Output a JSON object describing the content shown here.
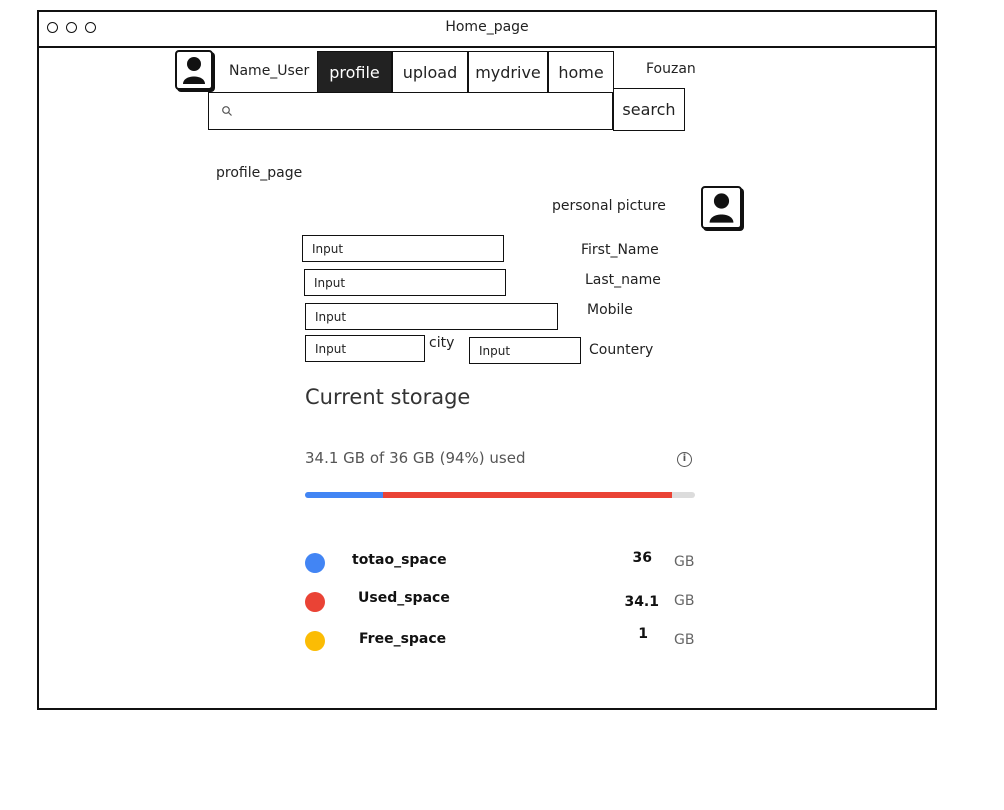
{
  "window": {
    "title": "Home_page"
  },
  "nav": {
    "username": "Name_User",
    "tabs": [
      "profile",
      "upload",
      "mydrive",
      "home"
    ],
    "right_name": "Fouzan"
  },
  "search": {
    "button": "search",
    "placeholder": ""
  },
  "profile": {
    "title": "profile_page",
    "picture_label": "personal picture",
    "fields": [
      {
        "label": "First_Name",
        "value": "Input"
      },
      {
        "label": "Last_name",
        "value": "Input"
      },
      {
        "label": "Mobile",
        "value": "Input"
      }
    ],
    "city": {
      "label": "city",
      "value": "Input"
    },
    "country": {
      "label": "Countery",
      "value": "Input"
    }
  },
  "storage": {
    "title": "Current storage",
    "usage": "34.1 GB of 36 GB (94%) used",
    "info_icon": "i",
    "usage_fraction_blue": 0.2,
    "usage_fraction_red": 0.94,
    "colors": {
      "blue": "#4285f4",
      "red": "#ea4335",
      "yellow": "#fbbc04",
      "track": "#dcdcdc"
    },
    "items": [
      {
        "name": "totao_space",
        "value": "36",
        "unit": "GB",
        "color": "#4285f4"
      },
      {
        "name": "Used_space",
        "value": "34.1",
        "unit": "GB",
        "color": "#ea4335"
      },
      {
        "name": "Free_space",
        "value": "1",
        "unit": "GB",
        "color": "#fbbc04"
      }
    ]
  }
}
